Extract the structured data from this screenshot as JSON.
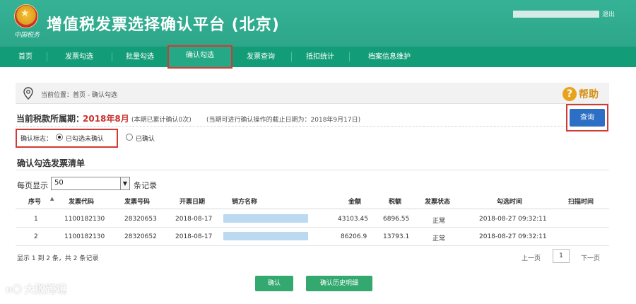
{
  "header": {
    "title": "增值税发票选择确认平台 (北京)",
    "emblem_script": "中国税务",
    "logout": "退出"
  },
  "nav": {
    "items": [
      "首页",
      "发票勾选",
      "批量勾选",
      "确认勾选",
      "发票查询",
      "抵扣统计",
      "档案信息维护"
    ],
    "active_index": 3
  },
  "location": {
    "text": "当前位置：首页 - 确认勾选",
    "help_label": "帮助"
  },
  "period": {
    "label": "当前税款所属期：",
    "value": "2018年8月",
    "note1": "(本期已累计确认0次)",
    "note2": "(当期可进行确认操作的截止日期为：2018年9月17日)"
  },
  "query_button": "查询",
  "status": {
    "label": "确认标志：",
    "options": [
      {
        "label": "已勾选未确认",
        "checked": true
      },
      {
        "label": "已确认",
        "checked": false
      }
    ]
  },
  "list": {
    "title": "确认勾选发票清单",
    "per_page_label": "每页显示",
    "per_page_value": "50",
    "per_page_suffix": "条记录",
    "columns": [
      "序号",
      "发票代码",
      "发票号码",
      "开票日期",
      "销方名称",
      "金额",
      "税额",
      "发票状态",
      "勾选时间",
      "扫描时间"
    ],
    "sort_indicator": "▲",
    "rows": [
      {
        "index": "1",
        "code": "1100182130",
        "number": "28320653",
        "date": "2018-08-17",
        "seller": "",
        "amount": "43103.45",
        "tax": "6896.55",
        "status": "正常",
        "check_time": "2018-08-27 09:32:11",
        "scan_time": ""
      },
      {
        "index": "2",
        "code": "1100182130",
        "number": "28320652",
        "date": "2018-08-17",
        "seller": "",
        "amount": "86206.9",
        "tax": "13793.1",
        "status": "正常",
        "check_time": "2018-08-27 09:32:11",
        "scan_time": ""
      }
    ]
  },
  "summary": "显示 1 到 2 条，共 2 条记录",
  "pager": {
    "prev": "上一页",
    "current": "1",
    "next": "下一页"
  },
  "buttons": {
    "confirm": "确认",
    "history": "确认历史明细"
  },
  "watermark": "大败跨境",
  "colors": {
    "header": "#2da689",
    "nav": "#139c78",
    "highlight": "#d23b32",
    "query": "#2d6fc4",
    "confirm": "#33a86f",
    "period_value": "#c9302c"
  }
}
